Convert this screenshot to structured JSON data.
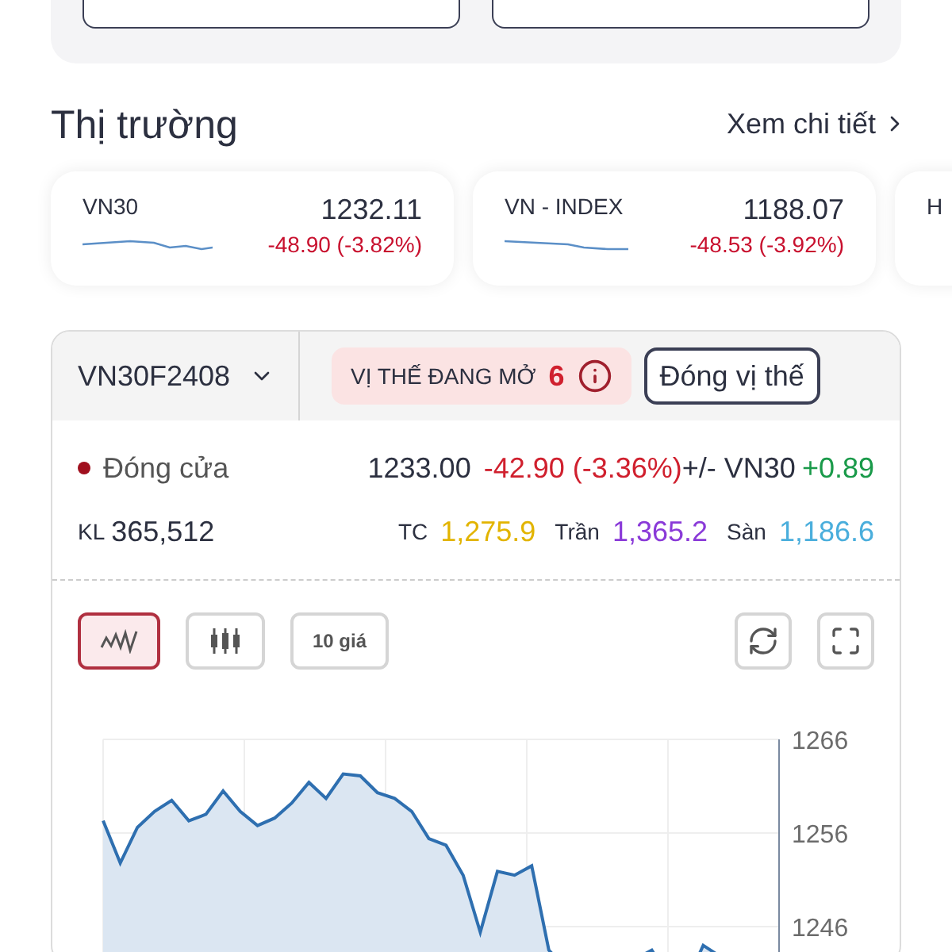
{
  "market": {
    "title": "Thị trường",
    "link": "Xem chi tiết",
    "cards": [
      {
        "name": "VN30",
        "value": "1232.11",
        "change": "-48.90 (-3.82%)"
      },
      {
        "name": "VN - INDEX",
        "value": "1188.07",
        "change": "-48.53 (-3.92%)"
      },
      {
        "name": "H"
      }
    ]
  },
  "contract": {
    "symbol": "VN30F2408",
    "positions_label": "VỊ THẾ ĐANG MỞ",
    "positions_count": "6",
    "close_button": "Đóng vị thế",
    "status": "Đóng cửa",
    "price": "1233.00",
    "change": "-42.90 (-3.36%)",
    "basis_label": "+/- VN30",
    "basis": "+0.89",
    "volume_label": "KL",
    "volume": "365,512",
    "ref_label": "TC",
    "ref": "1,275.9",
    "ceiling_label": "Trần",
    "ceiling": "1,365.2",
    "floor_label": "Sàn",
    "floor": "1,186.6"
  },
  "chart_tools": [
    {
      "kind": "line",
      "selected": true
    },
    {
      "kind": "candle",
      "selected": false
    },
    {
      "kind": "text",
      "label": "10 giá",
      "selected": false
    }
  ],
  "chart_actions": [
    {
      "kind": "rotate"
    },
    {
      "kind": "fullscreen"
    }
  ],
  "chart_data": {
    "type": "area",
    "grid": true,
    "yticks": [
      1266,
      1256,
      1246
    ],
    "ylim": [
      1239,
      1266
    ],
    "series": [
      {
        "color": "#2e6fb0",
        "values": [
          1257.3,
          1252.8,
          1256.6,
          1258.3,
          1259.5,
          1257.3,
          1258,
          1260.5,
          1258.3,
          1256.8,
          1257.6,
          1259.2,
          1261.4,
          1259.7,
          1262.3,
          1262.1,
          1260.3,
          1259.7,
          1258.3,
          1255.4,
          1254.7,
          1251.5,
          1245.4,
          1251.9,
          1251.5,
          1252.5,
          1243.5,
          1241.5,
          1242.5,
          1240.2,
          1242.5,
          1242.5,
          1243.5,
          1240.5,
          1239.9,
          1244,
          1242.8
        ]
      }
    ]
  }
}
